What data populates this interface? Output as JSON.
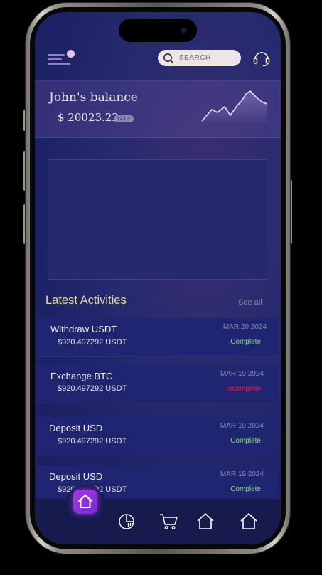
{
  "header": {
    "search_placeholder": "SEARCH",
    "icons": [
      "menu-icon",
      "search-icon",
      "headset-icon"
    ]
  },
  "balance": {
    "title": "John's balance",
    "amount": "$ 20023.22",
    "change_badge": "+23 ↗"
  },
  "activities": {
    "title": "Latest Activities",
    "see_all": "See all",
    "items": [
      {
        "title": "Withdraw USDT",
        "amount": "$920.497292 USDT",
        "date": "MAR 20 2024",
        "status": "Complete",
        "status_color": "#7ee07a"
      },
      {
        "title": "Exchange BTC",
        "amount": "$920.497292 USDT",
        "date": "MAR 19 2024",
        "status": "Incomplete",
        "status_color": "#e0233a"
      },
      {
        "title": "Deposit USD",
        "amount": "$920.497292 USDT",
        "date": "MAR 19 2024",
        "status": "Complete",
        "status_color": "#7ee07a"
      },
      {
        "title": "Deposit USD",
        "amount": "$920.497292 USDT",
        "date": "MAR 19 2024",
        "status": "Complete",
        "status_color": "#7ee07a"
      }
    ]
  },
  "bottom_nav": {
    "items": [
      "home-icon",
      "chart-icon",
      "cart-icon",
      "home-icon",
      "home-icon"
    ],
    "active": "home",
    "accent": "#9b35de"
  }
}
